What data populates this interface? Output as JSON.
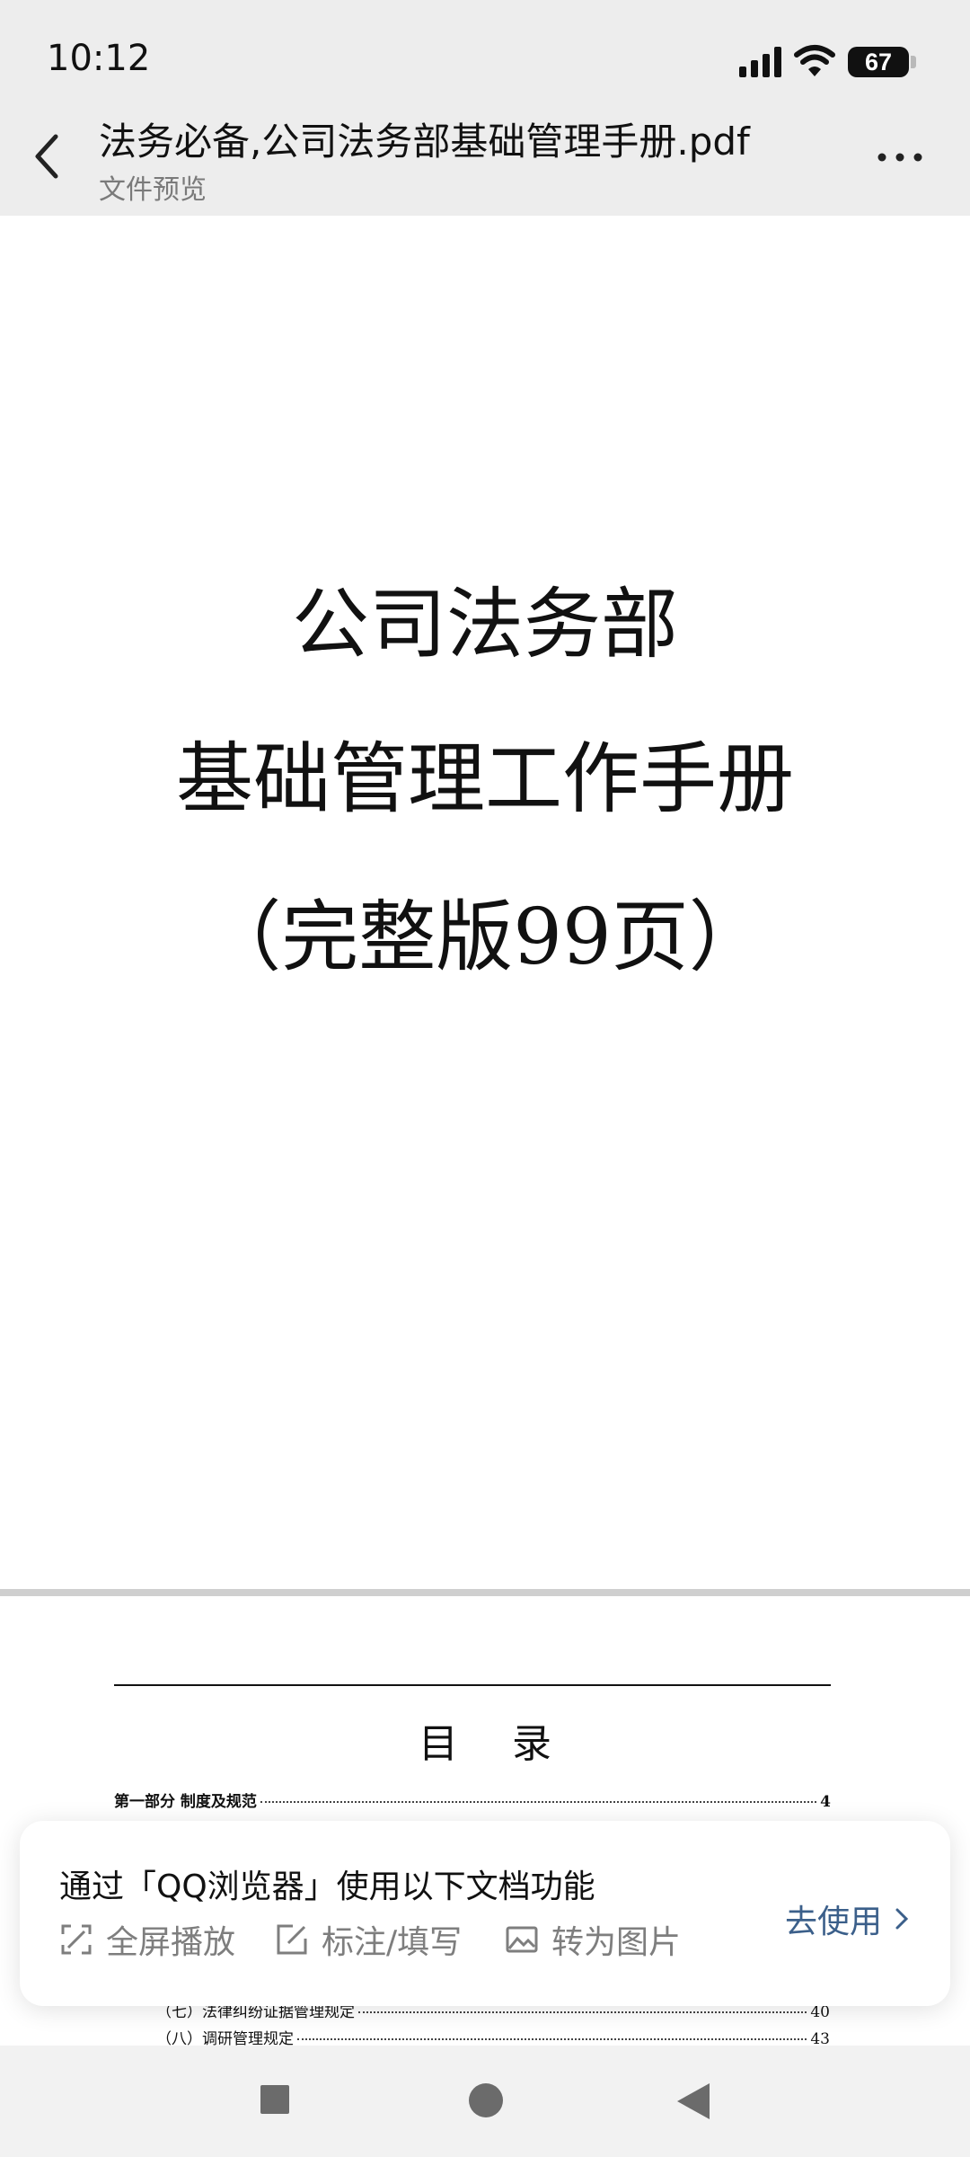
{
  "status_bar": {
    "time": "10:12",
    "battery": "67"
  },
  "title_bar": {
    "title": "法务必备,公司法务部基础管理手册.pdf",
    "subtitle": "文件预览"
  },
  "cover": {
    "line1": "公司法务部",
    "line2": "基础管理工作手册",
    "line3": "（完整版99页）"
  },
  "toc": {
    "title": "目录",
    "rows": [
      {
        "label": "第一部分  制度及规范",
        "page": "4"
      },
      {
        "label": "（七）法律纠纷证据管理规定",
        "page": "40"
      },
      {
        "label": "（八）调研管理规定",
        "page": "43"
      }
    ]
  },
  "promo": {
    "title": "通过「QQ浏览器」使用以下文档功能",
    "features": [
      "全屏播放",
      "标注/填写",
      "转为图片"
    ],
    "cta": "去使用"
  },
  "colors": {
    "topbar_bg": "#ededed",
    "cta": "#3b5f8a",
    "feature_gray": "#7e7e7e"
  },
  "icons": [
    "back-arrow-icon",
    "more-icon",
    "signal-icon",
    "wifi-icon",
    "battery-icon",
    "fullscreen-icon",
    "edit-icon",
    "image-icon",
    "chevron-right-icon",
    "nav-recent-icon",
    "nav-home-icon",
    "nav-back-icon"
  ]
}
